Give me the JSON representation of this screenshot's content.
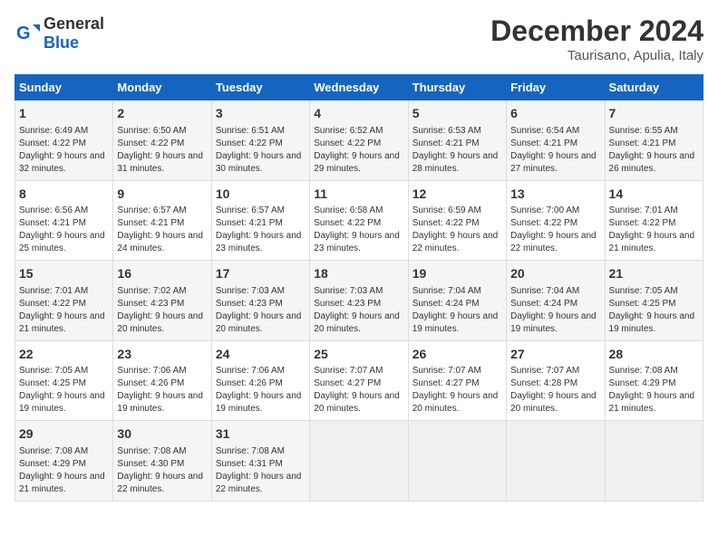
{
  "header": {
    "logo_general": "General",
    "logo_blue": "Blue",
    "main_title": "December 2024",
    "subtitle": "Taurisano, Apulia, Italy"
  },
  "weekdays": [
    "Sunday",
    "Monday",
    "Tuesday",
    "Wednesday",
    "Thursday",
    "Friday",
    "Saturday"
  ],
  "weeks": [
    [
      {
        "day": "1",
        "sunrise": "6:49 AM",
        "sunset": "4:22 PM",
        "daylight": "9 hours and 32 minutes."
      },
      {
        "day": "2",
        "sunrise": "6:50 AM",
        "sunset": "4:22 PM",
        "daylight": "9 hours and 31 minutes."
      },
      {
        "day": "3",
        "sunrise": "6:51 AM",
        "sunset": "4:22 PM",
        "daylight": "9 hours and 30 minutes."
      },
      {
        "day": "4",
        "sunrise": "6:52 AM",
        "sunset": "4:22 PM",
        "daylight": "9 hours and 29 minutes."
      },
      {
        "day": "5",
        "sunrise": "6:53 AM",
        "sunset": "4:21 PM",
        "daylight": "9 hours and 28 minutes."
      },
      {
        "day": "6",
        "sunrise": "6:54 AM",
        "sunset": "4:21 PM",
        "daylight": "9 hours and 27 minutes."
      },
      {
        "day": "7",
        "sunrise": "6:55 AM",
        "sunset": "4:21 PM",
        "daylight": "9 hours and 26 minutes."
      }
    ],
    [
      {
        "day": "8",
        "sunrise": "6:56 AM",
        "sunset": "4:21 PM",
        "daylight": "9 hours and 25 minutes."
      },
      {
        "day": "9",
        "sunrise": "6:57 AM",
        "sunset": "4:21 PM",
        "daylight": "9 hours and 24 minutes."
      },
      {
        "day": "10",
        "sunrise": "6:57 AM",
        "sunset": "4:21 PM",
        "daylight": "9 hours and 23 minutes."
      },
      {
        "day": "11",
        "sunrise": "6:58 AM",
        "sunset": "4:22 PM",
        "daylight": "9 hours and 23 minutes."
      },
      {
        "day": "12",
        "sunrise": "6:59 AM",
        "sunset": "4:22 PM",
        "daylight": "9 hours and 22 minutes."
      },
      {
        "day": "13",
        "sunrise": "7:00 AM",
        "sunset": "4:22 PM",
        "daylight": "9 hours and 22 minutes."
      },
      {
        "day": "14",
        "sunrise": "7:01 AM",
        "sunset": "4:22 PM",
        "daylight": "9 hours and 21 minutes."
      }
    ],
    [
      {
        "day": "15",
        "sunrise": "7:01 AM",
        "sunset": "4:22 PM",
        "daylight": "9 hours and 21 minutes."
      },
      {
        "day": "16",
        "sunrise": "7:02 AM",
        "sunset": "4:23 PM",
        "daylight": "9 hours and 20 minutes."
      },
      {
        "day": "17",
        "sunrise": "7:03 AM",
        "sunset": "4:23 PM",
        "daylight": "9 hours and 20 minutes."
      },
      {
        "day": "18",
        "sunrise": "7:03 AM",
        "sunset": "4:23 PM",
        "daylight": "9 hours and 20 minutes."
      },
      {
        "day": "19",
        "sunrise": "7:04 AM",
        "sunset": "4:24 PM",
        "daylight": "9 hours and 19 minutes."
      },
      {
        "day": "20",
        "sunrise": "7:04 AM",
        "sunset": "4:24 PM",
        "daylight": "9 hours and 19 minutes."
      },
      {
        "day": "21",
        "sunrise": "7:05 AM",
        "sunset": "4:25 PM",
        "daylight": "9 hours and 19 minutes."
      }
    ],
    [
      {
        "day": "22",
        "sunrise": "7:05 AM",
        "sunset": "4:25 PM",
        "daylight": "9 hours and 19 minutes."
      },
      {
        "day": "23",
        "sunrise": "7:06 AM",
        "sunset": "4:26 PM",
        "daylight": "9 hours and 19 minutes."
      },
      {
        "day": "24",
        "sunrise": "7:06 AM",
        "sunset": "4:26 PM",
        "daylight": "9 hours and 19 minutes."
      },
      {
        "day": "25",
        "sunrise": "7:07 AM",
        "sunset": "4:27 PM",
        "daylight": "9 hours and 20 minutes."
      },
      {
        "day": "26",
        "sunrise": "7:07 AM",
        "sunset": "4:27 PM",
        "daylight": "9 hours and 20 minutes."
      },
      {
        "day": "27",
        "sunrise": "7:07 AM",
        "sunset": "4:28 PM",
        "daylight": "9 hours and 20 minutes."
      },
      {
        "day": "28",
        "sunrise": "7:08 AM",
        "sunset": "4:29 PM",
        "daylight": "9 hours and 21 minutes."
      }
    ],
    [
      {
        "day": "29",
        "sunrise": "7:08 AM",
        "sunset": "4:29 PM",
        "daylight": "9 hours and 21 minutes."
      },
      {
        "day": "30",
        "sunrise": "7:08 AM",
        "sunset": "4:30 PM",
        "daylight": "9 hours and 22 minutes."
      },
      {
        "day": "31",
        "sunrise": "7:08 AM",
        "sunset": "4:31 PM",
        "daylight": "9 hours and 22 minutes."
      },
      null,
      null,
      null,
      null
    ]
  ]
}
